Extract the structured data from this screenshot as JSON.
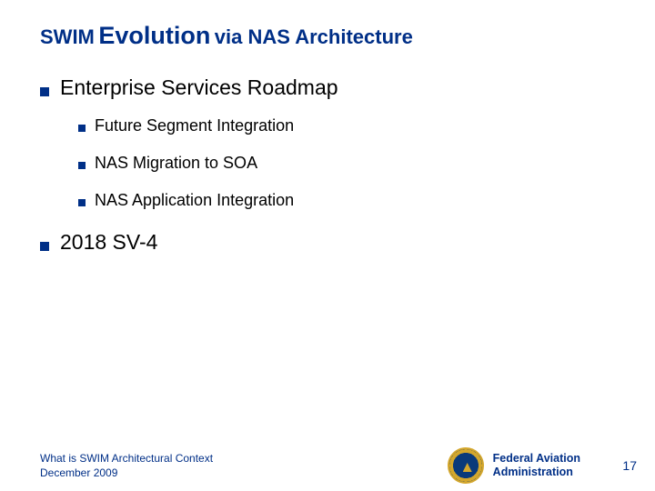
{
  "title": {
    "part1": "SWIM",
    "part2": "Evolution",
    "part3": "via NAS Architecture"
  },
  "bullets": [
    {
      "text": "Enterprise Services Roadmap",
      "children": [
        {
          "text": "Future Segment Integration"
        },
        {
          "text": "NAS Migration to SOA"
        },
        {
          "text": "NAS Application Integration"
        }
      ]
    },
    {
      "text": "2018 SV-4"
    }
  ],
  "footer": {
    "line1": "What is SWIM Architectural Context",
    "line2": "December 2009",
    "agency_line1": "Federal Aviation",
    "agency_line2": "Administration",
    "page": "17"
  }
}
